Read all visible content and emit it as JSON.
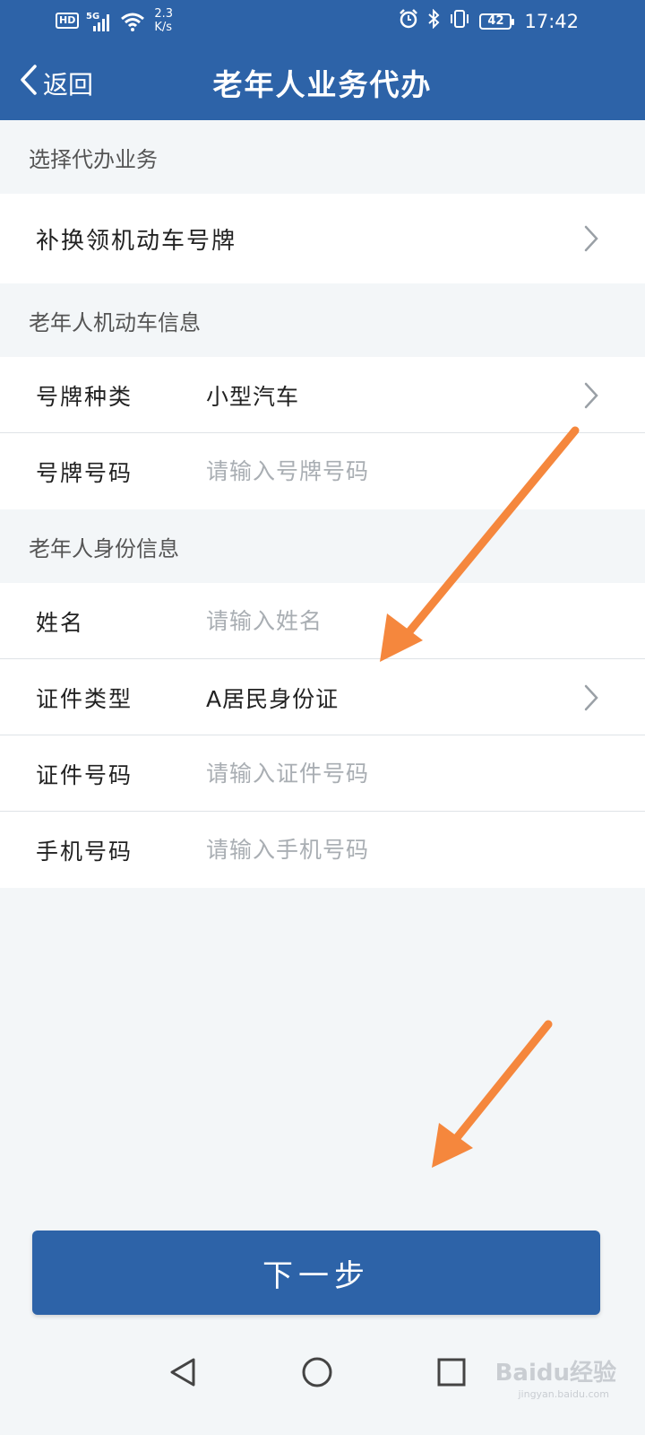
{
  "status_bar": {
    "hd_label": "HD",
    "network_label": "5G",
    "speed_value": "2.3",
    "speed_unit": "K/s",
    "battery_level": "42",
    "time": "17:42"
  },
  "nav": {
    "back_label": "返回",
    "title": "老年人业务代办"
  },
  "sections": {
    "service": {
      "header": "选择代办业务",
      "selected_service": "补换领机动车号牌"
    },
    "vehicle": {
      "header": "老年人机动车信息",
      "plate_type_label": "号牌种类",
      "plate_type_value": "小型汽车",
      "plate_number_label": "号牌号码",
      "plate_number_placeholder": "请输入号牌号码"
    },
    "identity": {
      "header": "老年人身份信息",
      "name_label": "姓名",
      "name_placeholder": "请输入姓名",
      "id_type_label": "证件类型",
      "id_type_value": "A居民身份证",
      "id_number_label": "证件号码",
      "id_number_placeholder": "请输入证件号码",
      "phone_label": "手机号码",
      "phone_placeholder": "请输入手机号码"
    }
  },
  "buttons": {
    "next_label": "下一步"
  },
  "watermark": {
    "brand": "Baidu经验",
    "url": "jingyan.baidu.com"
  },
  "colors": {
    "primary": "#2d63a8",
    "background": "#f3f6f8",
    "annotation_arrow": "#f5873d"
  },
  "icons": [
    "back-chevron-icon",
    "chevron-right-icon",
    "alarm-icon",
    "bluetooth-icon",
    "vibrate-icon",
    "wifi-icon",
    "signal-icon",
    "nav-back-icon",
    "nav-home-icon",
    "nav-recents-icon"
  ]
}
